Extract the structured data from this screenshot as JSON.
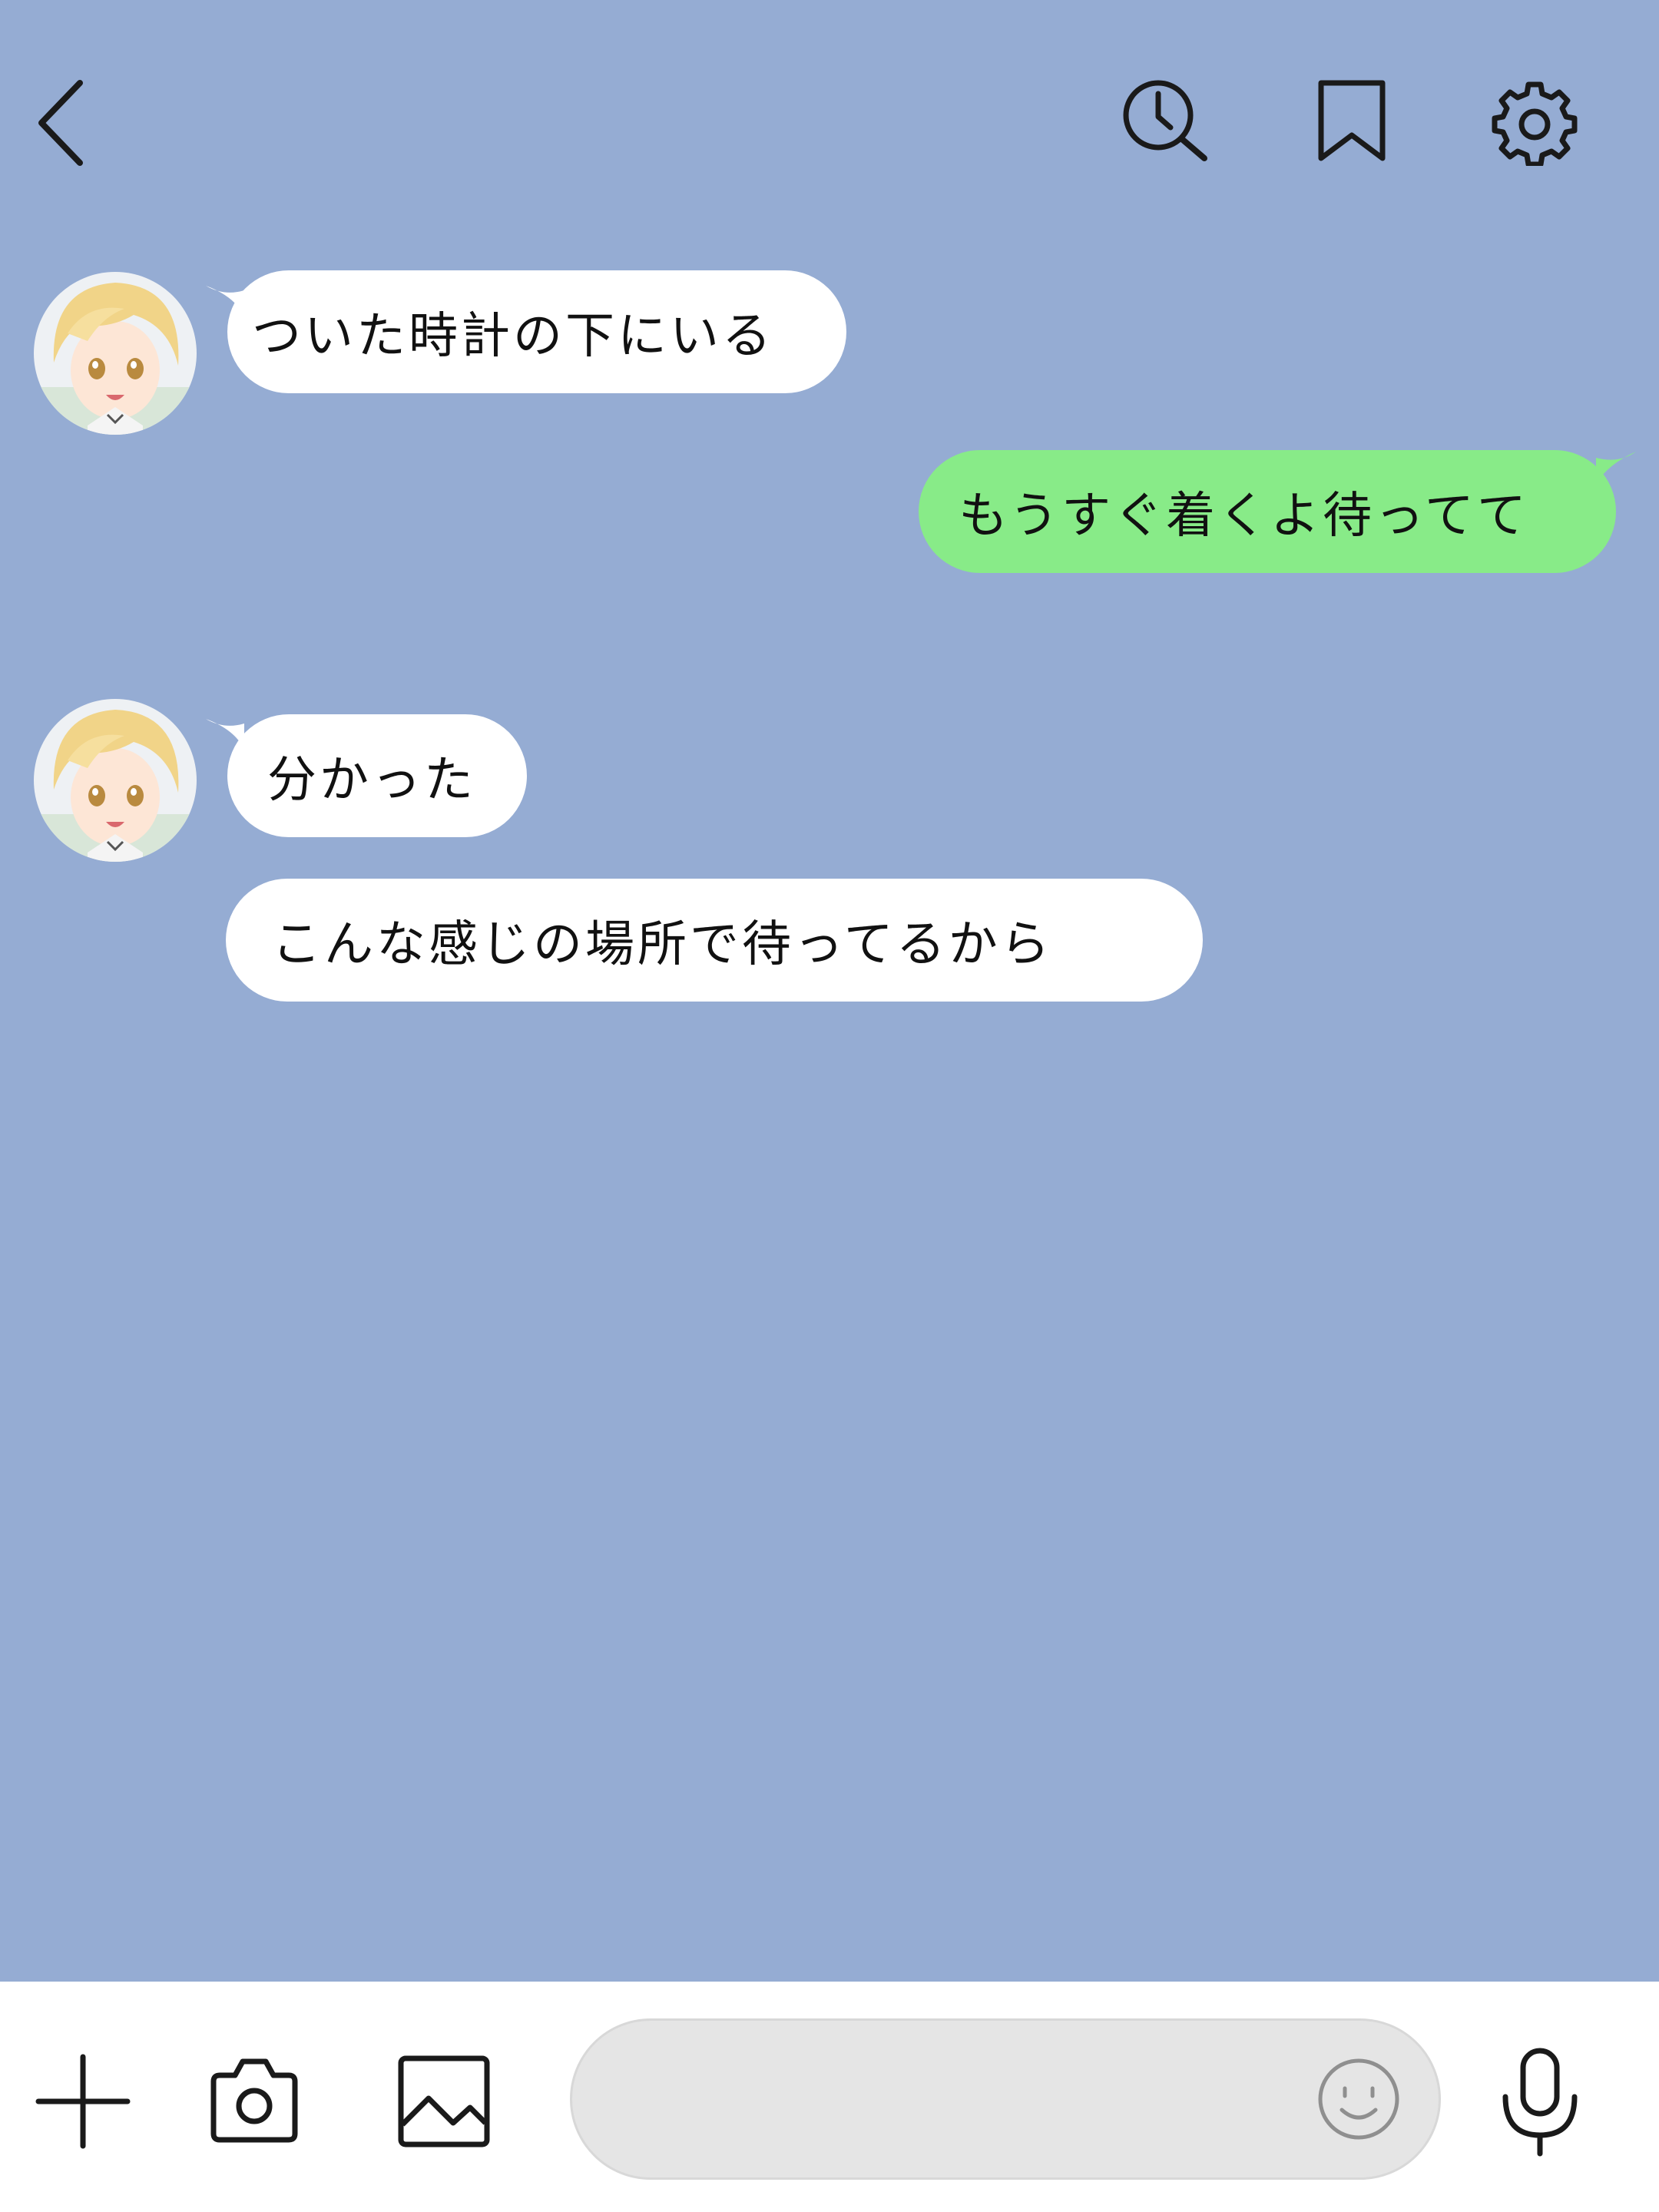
{
  "theme": {
    "background": "#95acd3",
    "incoming_bubble": "#ffffff",
    "outgoing_bubble": "#88eb88",
    "icon_color": "#1a1a1a"
  },
  "header": {
    "icons": [
      "chevron-left-icon",
      "history-search-icon",
      "bookmark-icon",
      "gear-icon"
    ]
  },
  "messages": [
    {
      "direction": "incoming",
      "text": "ついた時計の下にいる",
      "sender_avatar": "avatar"
    },
    {
      "direction": "outgoing",
      "text": "もうすぐ着くよ待ってて"
    },
    {
      "direction": "incoming",
      "text": "分かった",
      "sender_avatar": "avatar"
    },
    {
      "direction": "incoming",
      "text": "こんな感じの場所で待ってるから"
    }
  ],
  "input_bar": {
    "icons": [
      "plus-icon",
      "camera-icon",
      "image-icon",
      "emoji-icon",
      "microphone-icon"
    ],
    "message_value": "",
    "message_placeholder": ""
  }
}
